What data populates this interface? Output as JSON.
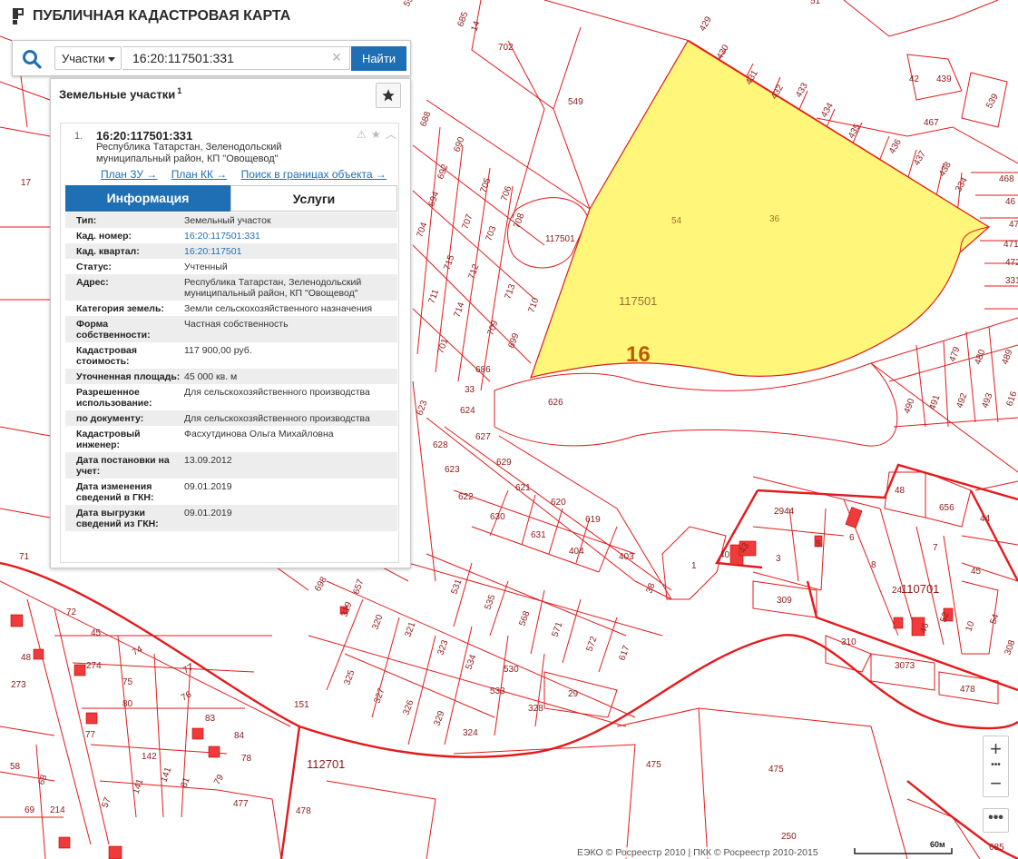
{
  "app": {
    "title": "ПУБЛИЧНАЯ КАДАСТРОВАЯ КАРТА"
  },
  "search": {
    "type_label": "Участки",
    "query": "16:20:117501:331",
    "find_label": "Найти",
    "clear_glyph": "×"
  },
  "panel": {
    "title": "Земельные участки",
    "count": "1"
  },
  "result": {
    "number": "1.",
    "id": "16:20:117501:331",
    "address": "Республика Татарстан, Зеленодольский муниципальный район, КП \"Овощевод\"",
    "links": [
      "План ЗУ →",
      "План КК →",
      "Поиск в границах объекта →"
    ],
    "tabs": [
      "Информация",
      "Услуги"
    ],
    "info": [
      {
        "key": "Тип:",
        "value": "Земельный участок"
      },
      {
        "key": "Кад. номер:",
        "value": "16:20:117501:331",
        "link": true
      },
      {
        "key": "Кад. квартал:",
        "value": "16:20:117501",
        "link": true
      },
      {
        "key": "Статус:",
        "value": "Учтенный"
      },
      {
        "key": "Адрес:",
        "value": "Республика Татарстан, Зеленодольский муниципальный район, КП \"Овощевод\""
      },
      {
        "key": "Категория земель:",
        "value": "Земли сельскохозяйственного назначения"
      },
      {
        "key": "Форма собственности:",
        "value": "Частная собственность"
      },
      {
        "key": "Кадастровая стоимость:",
        "value": "117 900,00 руб."
      },
      {
        "key": "Уточненная площадь:",
        "value": "45 000 кв. м"
      },
      {
        "key": "Разрешенное использование:",
        "value": "Для сельскохозяйственного производства"
      },
      {
        "key": "по документу:",
        "value": "Для сельскохозяйственного производства"
      },
      {
        "key": "Кадастровый инженер:",
        "value": "Фасхутдинова Ольга Михайловна"
      },
      {
        "key": "Дата постановки на учет:",
        "value": "13.09.2012"
      },
      {
        "key": "Дата изменения сведений в ГКН:",
        "value": "09.01.2019"
      },
      {
        "key": "Дата выгрузки сведений из ГКН:",
        "value": "09.01.2019"
      }
    ]
  },
  "map": {
    "highlight_color": "#fff67a",
    "boundary_color": "#e31a1c",
    "district_label": "16",
    "quarter_labels": [
      "117501",
      "110701",
      "112701"
    ],
    "parcel_labels": [
      "702",
      "685",
      "549",
      "429",
      "430",
      "431",
      "432",
      "433",
      "434",
      "435",
      "436",
      "437",
      "438",
      "334",
      "42",
      "439",
      "539",
      "467",
      "468",
      "46",
      "470",
      "471",
      "472",
      "331",
      "54",
      "36",
      "117501",
      "687",
      "688",
      "690",
      "692",
      "694",
      "704",
      "705",
      "706",
      "707",
      "703",
      "708",
      "715",
      "712",
      "713",
      "710",
      "711",
      "714",
      "709",
      "699",
      "701",
      "686",
      "33",
      "626",
      "623",
      "624",
      "627",
      "628",
      "623",
      "629",
      "622",
      "621",
      "620",
      "619",
      "630",
      "631",
      "404",
      "403",
      "38",
      "1",
      "2944",
      "48",
      "656",
      "44",
      "40",
      "43",
      "3",
      "5",
      "6",
      "8",
      "7",
      "24",
      "45",
      "52",
      "46",
      "10",
      "54",
      "308",
      "309",
      "310",
      "3073",
      "478",
      "479",
      "480",
      "489",
      "490",
      "491",
      "492",
      "493",
      "616",
      "698",
      "657",
      "319",
      "320",
      "321",
      "323",
      "325",
      "327",
      "326",
      "329",
      "324",
      "534",
      "533",
      "530",
      "531",
      "535",
      "568",
      "571",
      "572",
      "617",
      "328",
      "29",
      "151",
      "71",
      "72",
      "45",
      "48",
      "273",
      "274",
      "74",
      "75",
      "77",
      "76",
      "77",
      "80",
      "83",
      "84",
      "78",
      "142",
      "141",
      "141",
      "81",
      "79",
      "57",
      "58",
      "68",
      "69",
      "214",
      "477",
      "478",
      "475",
      "475",
      "250",
      "685",
      "14",
      "17",
      "553",
      "51"
    ],
    "scale_label": "60м",
    "copyright": "ЕЭКО © Росреестр 2010 | ПКК © Росреестр 2010-2015"
  },
  "colors": {
    "accent": "#1f6fb5",
    "parcel_line": "#e31a1c",
    "selected_fill": "#fff67a"
  },
  "icons": [
    "logo-icon",
    "search-icon",
    "chevron-down-icon",
    "clear-icon",
    "star-icon",
    "warning-icon",
    "star-outline-icon",
    "chevron-up-icon",
    "zoom-in-icon",
    "zoom-out-icon",
    "more-icon"
  ]
}
